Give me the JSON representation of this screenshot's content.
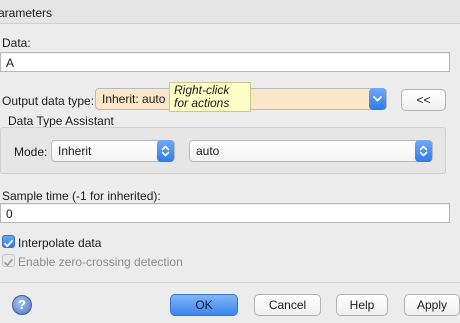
{
  "section_title": "arameters",
  "data_label": "Data:",
  "data_value": "A",
  "output_type_label": "Output data type:",
  "output_type_value": "Inherit: auto",
  "tooltip": "Right-click for actions",
  "collapse_button": "<<",
  "assistant": {
    "title": "Data Type Assistant",
    "mode_label": "Mode:",
    "mode_value": "Inherit",
    "type_value": "auto"
  },
  "sample_time_label": "Sample time (-1 for inherited):",
  "sample_time_value": "0",
  "interpolate_label": "Interpolate data",
  "zero_crossing_label": "Enable zero-crossing detection",
  "checkboxes": {
    "interpolate": true,
    "zero_crossing": true
  },
  "buttons": {
    "ok": "OK",
    "cancel": "Cancel",
    "help": "Help",
    "apply": "Apply"
  },
  "colors": {
    "accent": "#2f7ae9",
    "tooltip_bg": "#fdfdc6",
    "combo_highlight": "#fbe6c8"
  }
}
